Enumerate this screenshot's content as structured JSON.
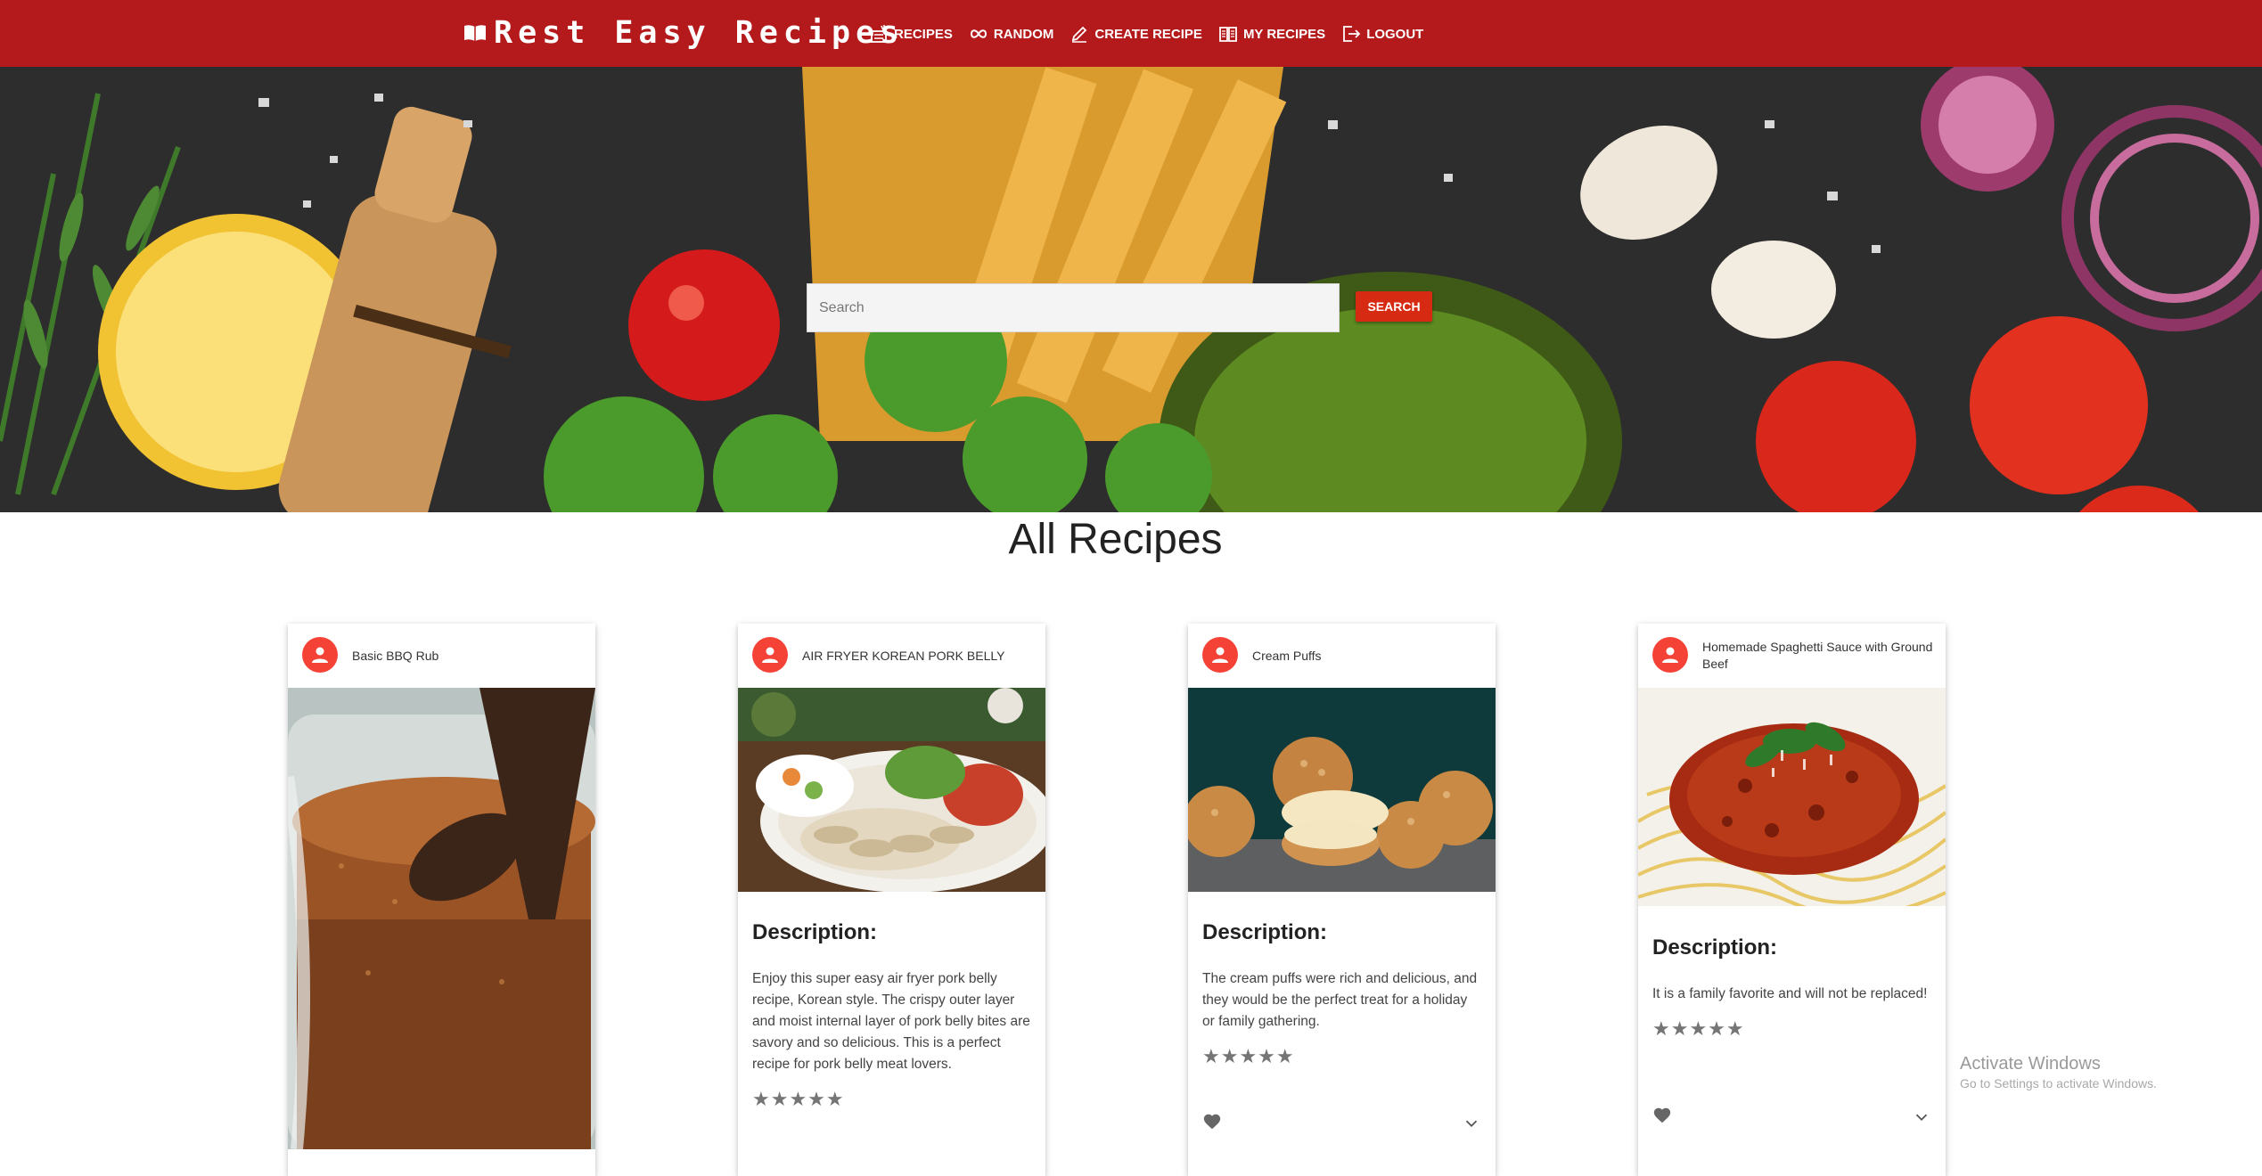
{
  "navbar": {
    "brand": "Rest Easy Recipes",
    "bg_color": "#b4191b",
    "items": [
      {
        "label": "RECIPES",
        "icon": "recipe-book-icon"
      },
      {
        "label": "RANDOM",
        "icon": "infinity-icon"
      },
      {
        "label": "CREATE RECIPE",
        "icon": "pencil-icon"
      },
      {
        "label": "MY RECIPES",
        "icon": "open-book-icon"
      },
      {
        "label": "LOGOUT",
        "icon": "logout-icon"
      }
    ]
  },
  "search": {
    "placeholder": "Search",
    "value": "",
    "button_label": "SEARCH",
    "button_color": "#d62a12"
  },
  "main": {
    "title": "All Recipes"
  },
  "recipes": [
    {
      "title": "Basic BBQ Rub",
      "image": "bbq-rub-spice-jar-photo",
      "description_heading": "",
      "description": ""
    },
    {
      "title": "AIR FRYER KOREAN PORK BELLY",
      "image": "korean-pork-belly-plate-photo",
      "description_heading": "Description:",
      "description": "Enjoy this super easy air fryer pork belly recipe, Korean style. The crispy outer layer and moist internal layer of pork belly bites are savory and so delicious. This is a perfect recipe for pork belly meat lovers.",
      "stars": "★★★★★"
    },
    {
      "title": "Cream Puffs",
      "image": "cream-puffs-photo",
      "description_heading": "Description:",
      "description": "The cream puffs were rich and delicious, and they would be the perfect treat for a holiday or family gathering.",
      "stars": "★★★★★"
    },
    {
      "title": "Homemade Spaghetti Sauce with Ground Beef",
      "image": "spaghetti-bolognese-photo",
      "description_heading": "Description:",
      "description": "It is a family favorite and will not be replaced!",
      "stars": "★★★★★"
    }
  ],
  "watermark": {
    "line1": "Activate Windows",
    "line2": "Go to Settings to activate Windows."
  }
}
